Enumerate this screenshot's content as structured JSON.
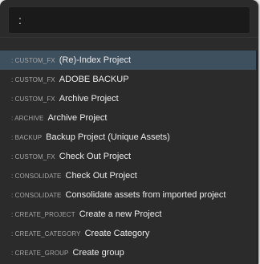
{
  "command_palette": {
    "query": ":",
    "items": [
      {
        "prefix": ": CUSTOM_FX",
        "label": "(Re)-Index Project",
        "selected": true
      },
      {
        "prefix": ": CUSTOM_FX",
        "label": "ADOBE BACKUP",
        "selected": false
      },
      {
        "prefix": ": CUSTOM_FX",
        "label": "Archive Project",
        "selected": false
      },
      {
        "prefix": ": ARCHIVE",
        "label": "Archive Project",
        "selected": false
      },
      {
        "prefix": ": BACKUP",
        "label": "Backup Project (Unique Assets)",
        "selected": false
      },
      {
        "prefix": ": CUSTOM_FX",
        "label": "Check Out Project",
        "selected": false
      },
      {
        "prefix": ": CONSOLIDATE",
        "label": "Check Out Project",
        "selected": false
      },
      {
        "prefix": ": CONSOLIDATE",
        "label": "Consolidate assets from imported project",
        "selected": false
      },
      {
        "prefix": ": CREATE_PROJECT",
        "label": "Create a new Project",
        "selected": false
      },
      {
        "prefix": ": CREATE_CATEGORY",
        "label": "Create Category",
        "selected": false
      },
      {
        "prefix": ": CREATE_GROUP",
        "label": "Create group",
        "selected": false
      }
    ]
  },
  "colors": {
    "background": "#2b2b2b",
    "input_background": "#1a1a1a",
    "selected_row": "#3e4f5e",
    "prefix_text": "#a6a6a6",
    "label_text": "#ececec"
  }
}
